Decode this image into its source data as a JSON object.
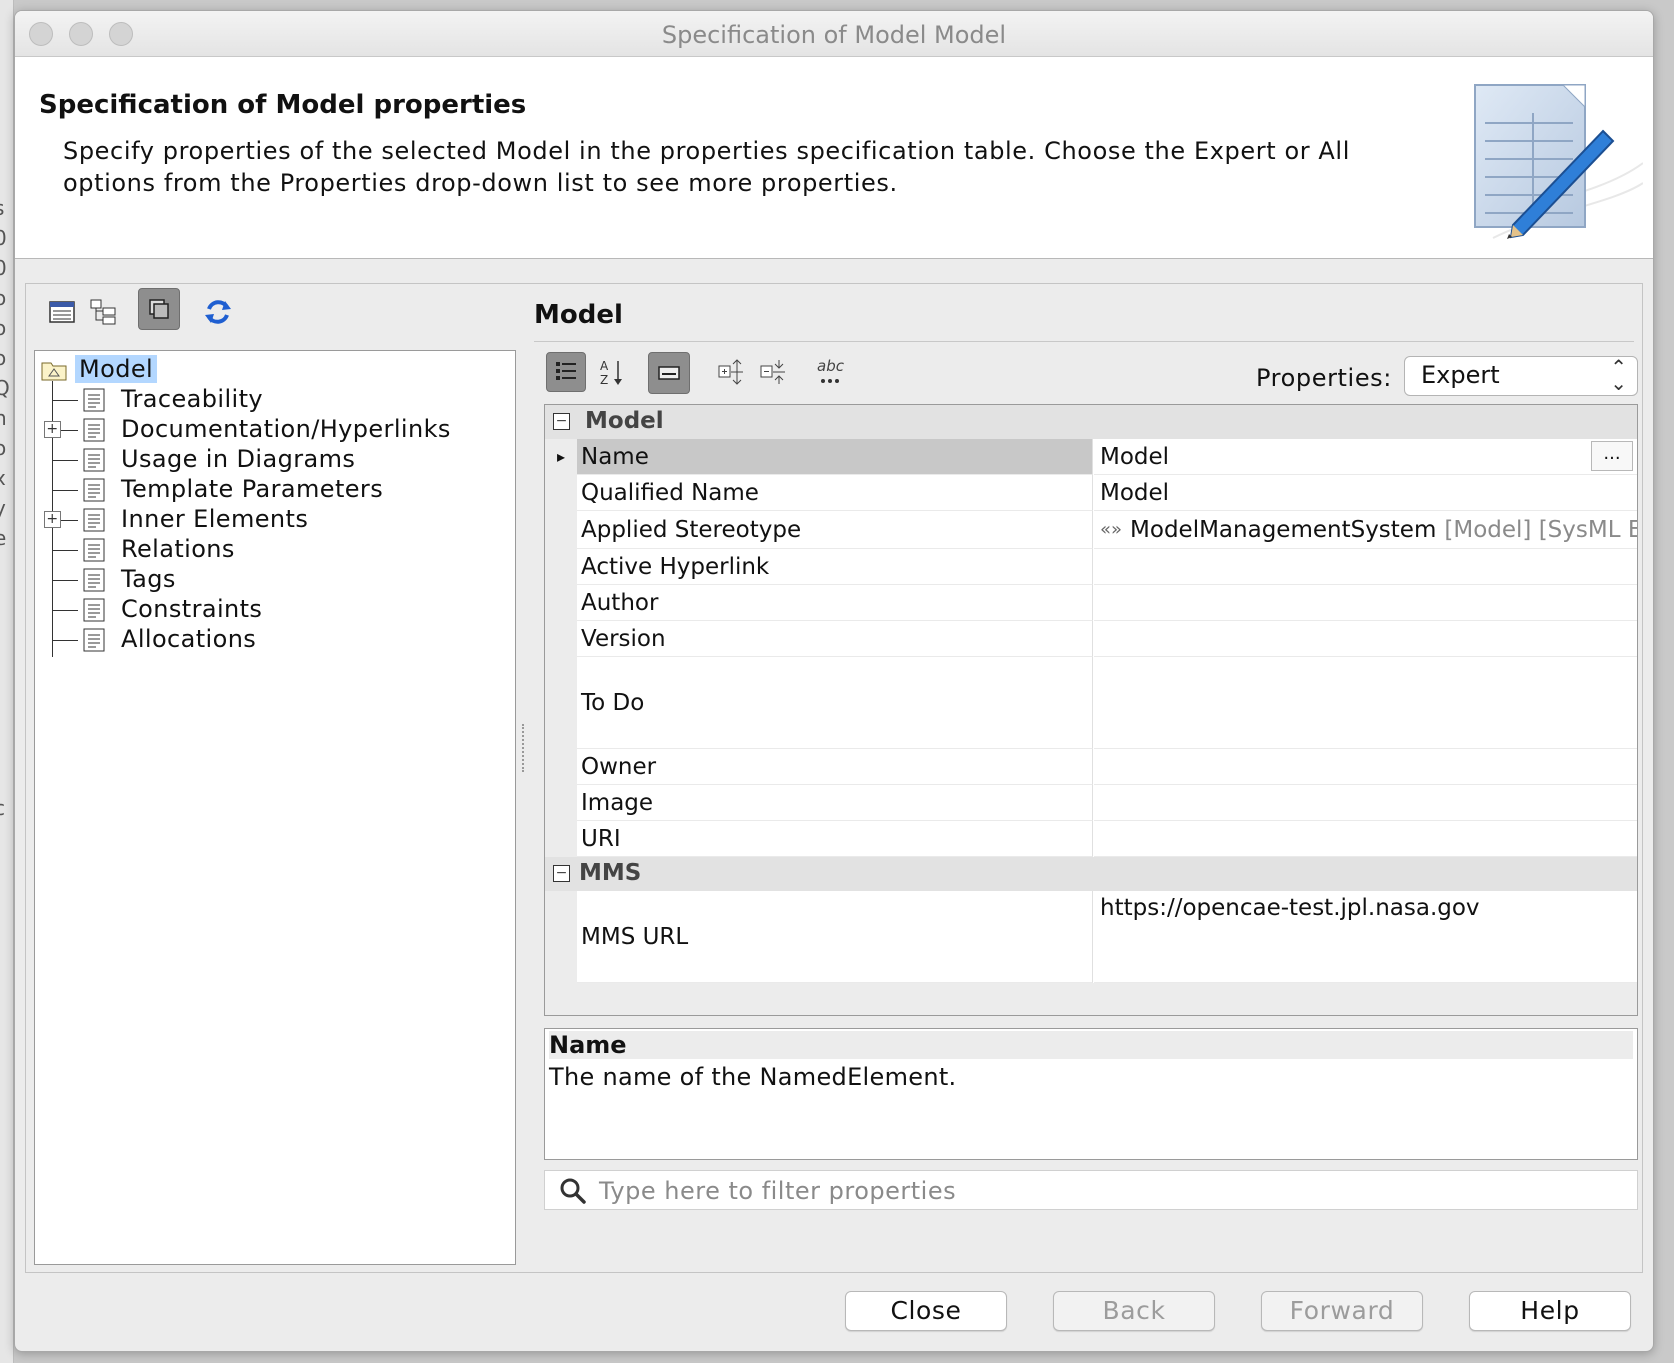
{
  "window": {
    "title": "Specification of Model Model"
  },
  "header": {
    "title": "Specification of Model properties",
    "description": "Specify properties of the selected Model in the properties specification table. Choose the Expert or All options from the Properties drop-down list to see more properties."
  },
  "tree": {
    "root": "Model",
    "items": [
      {
        "label": "Traceability",
        "expandable": false
      },
      {
        "label": "Documentation/Hyperlinks",
        "expandable": true
      },
      {
        "label": "Usage in Diagrams",
        "expandable": false
      },
      {
        "label": "Template Parameters",
        "expandable": false
      },
      {
        "label": "Inner Elements",
        "expandable": true
      },
      {
        "label": "Relations",
        "expandable": false
      },
      {
        "label": "Tags",
        "expandable": false
      },
      {
        "label": "Constraints",
        "expandable": false
      },
      {
        "label": "Allocations",
        "expandable": false
      }
    ]
  },
  "right": {
    "title": "Model",
    "properties_label": "Properties:",
    "properties_value": "Expert"
  },
  "grid": {
    "groups": [
      {
        "name": "Model",
        "rows": [
          {
            "name": "Name",
            "value": "Model",
            "selected": true,
            "has_more": true,
            "more_label": "..."
          },
          {
            "name": "Qualified Name",
            "value": "Model"
          },
          {
            "name": "Applied Stereotype",
            "value": "ModelManagementSystem",
            "value_prefix": "«»",
            "value_suffix": "[Model] [SysML E:"
          },
          {
            "name": "Active Hyperlink",
            "value": ""
          },
          {
            "name": "Author",
            "value": ""
          },
          {
            "name": "Version",
            "value": ""
          },
          {
            "name": "To Do",
            "value": ""
          },
          {
            "name": "Owner",
            "value": ""
          },
          {
            "name": "Image",
            "value": ""
          },
          {
            "name": "URI",
            "value": ""
          }
        ]
      },
      {
        "name": "MMS",
        "rows": [
          {
            "name": "MMS URL",
            "value": "https://opencae-test.jpl.nasa.gov"
          }
        ]
      }
    ]
  },
  "description": {
    "title": "Name",
    "text": "The name of the NamedElement."
  },
  "filter": {
    "placeholder": "Type here to filter properties"
  },
  "buttons": {
    "close": "Close",
    "back": "Back",
    "forward": "Forward",
    "help": "Help"
  },
  "colors": {
    "selection": "#b3d7ff",
    "accent": "#2a6fd6"
  }
}
